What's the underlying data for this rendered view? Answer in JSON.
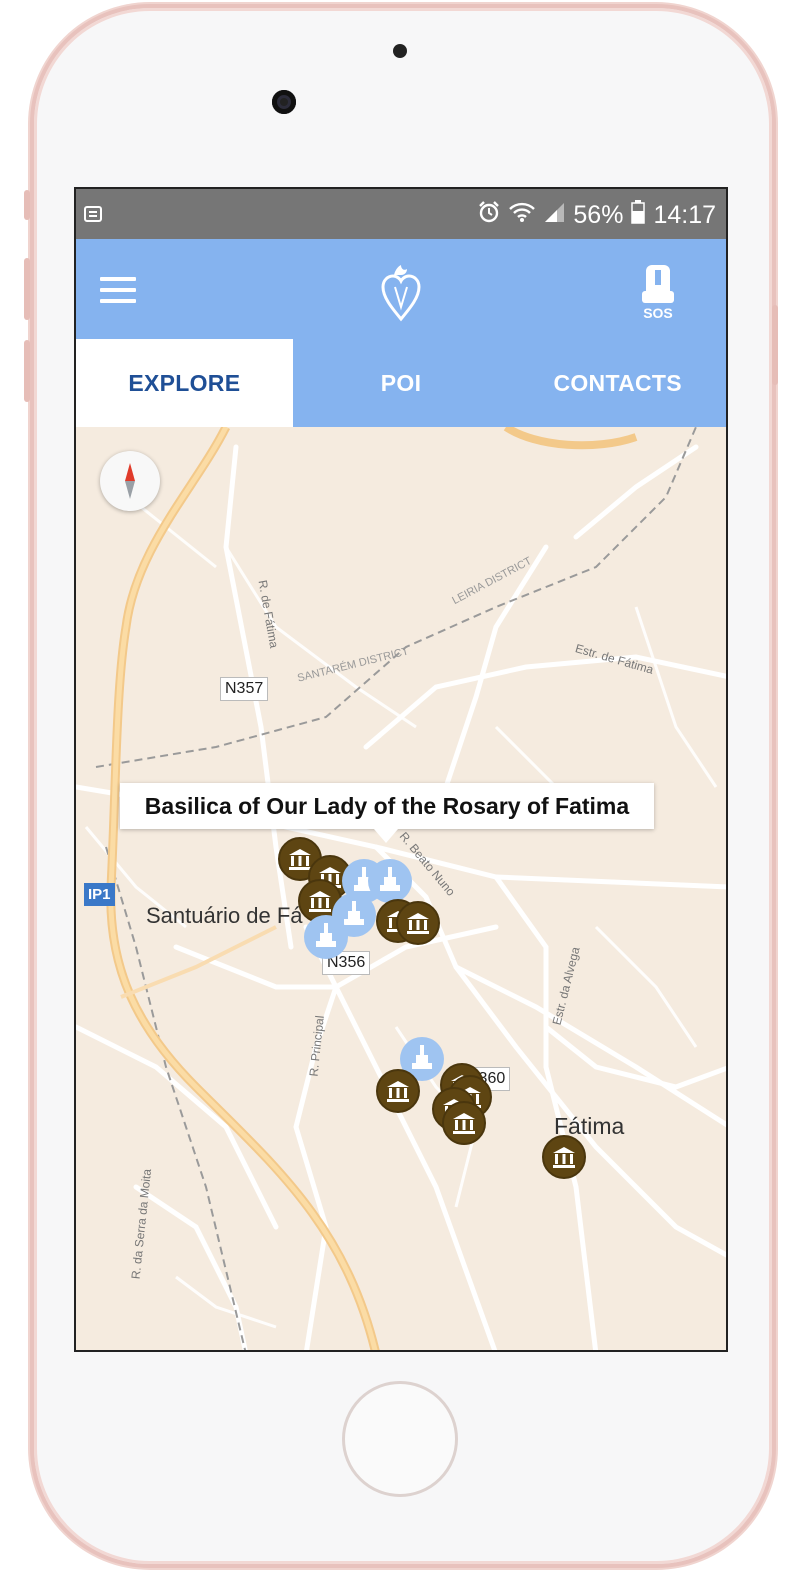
{
  "status_bar": {
    "battery": "56%",
    "time": "14:17"
  },
  "tabs": [
    {
      "label": "EXPLORE",
      "active": true
    },
    {
      "label": "POI",
      "active": false
    },
    {
      "label": "CONTACTS",
      "active": false
    }
  ],
  "appbar": {
    "sos_label": "SOS"
  },
  "map": {
    "tooltip": "Basilica of Our Lady of the Rosary of Fatima",
    "places": {
      "santuario": "Santuário de Fá",
      "fatima": "Fátima"
    },
    "road_labels": {
      "r_de_fatima": "R. de Fátima",
      "santarem_district": "SANTARÉM DISTRICT",
      "leiria_district": "LEIRIA DISTRICT",
      "estr_de_fatima": "Estr. de Fátima",
      "beato_nuno": "R. Beato Nuno",
      "estr_da_alvega": "Estr. da Alvega",
      "r_principal": "R. Principal",
      "r_serra_da_moita": "R. da Serra da Moita"
    },
    "shields": {
      "n357": "N357",
      "n356": "N356",
      "n360": "N360",
      "ip1": "IP1"
    }
  },
  "colors": {
    "appbar": "#85b3ef",
    "active_tab_text": "#1f4f96",
    "museum_marker": "#5e4512",
    "church_marker": "#9fc4f1",
    "map_bg": "#f5ebdf"
  }
}
